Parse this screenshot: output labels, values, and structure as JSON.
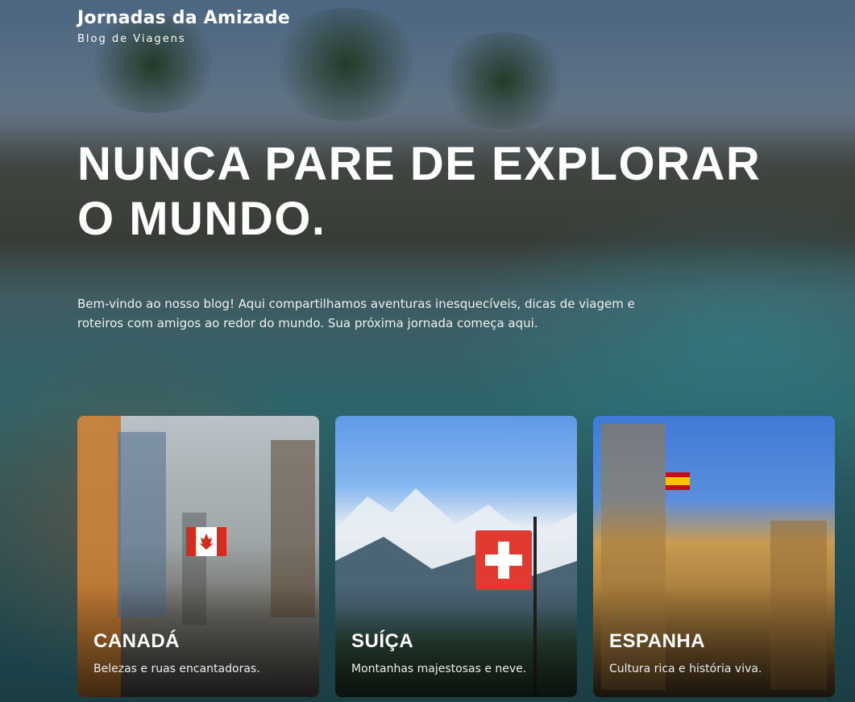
{
  "brand": {
    "title": "Jornadas da Amizade",
    "subtitle": "Blog de Viagens"
  },
  "hero": {
    "headline": "NUNCA PARE DE EXPLORAR O MUNDO.",
    "intro": "Bem-vindo ao nosso blog! Aqui compartilhamos aventuras inesquecíveis, dicas de viagem e roteiros com amigos ao redor do mundo. Sua próxima jornada começa aqui."
  },
  "cards": [
    {
      "title": "CANADÁ",
      "description": "Belezas e ruas encantadoras."
    },
    {
      "title": "SUÍÇA",
      "description": "Montanhas majestosas e neve."
    },
    {
      "title": "ESPANHA",
      "description": "Cultura rica e história viva."
    }
  ],
  "colors": {
    "text": "#ffffff",
    "canada_flag_red": "#d52b1e",
    "swiss_flag_red": "#e03a31",
    "spain_flag_red": "#c60b1e",
    "spain_flag_yellow": "#ffc400"
  }
}
